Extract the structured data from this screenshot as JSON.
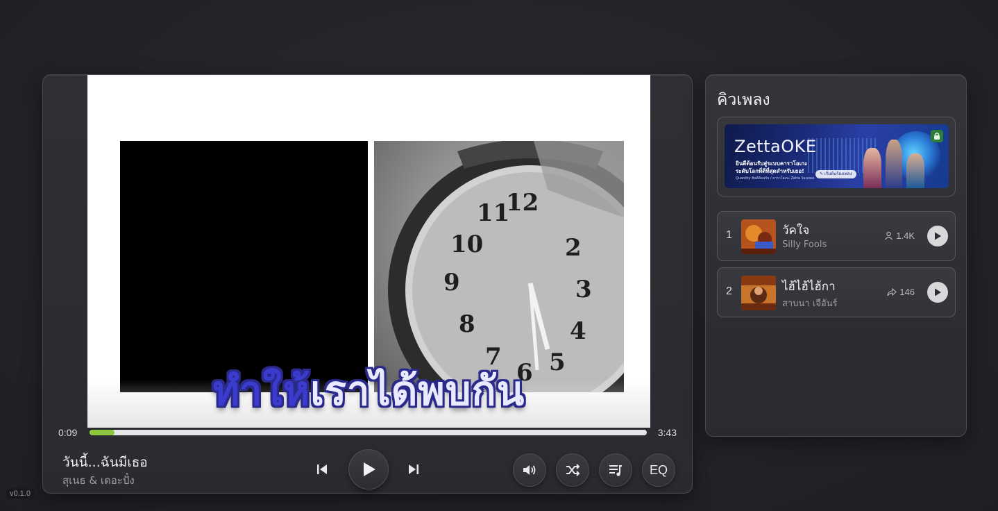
{
  "player": {
    "lyric_sung": "ทำให",
    "lyric_rest": "้เราได้พบกัน",
    "current_time": "0:09",
    "duration": "3:43",
    "progress": 0.045,
    "now_playing": {
      "title": "วันนี้...ฉันมีเธอ",
      "artist": "สุเนธ & เดอะปั๋ง"
    },
    "controls": {
      "prev_icon": "skip-previous-icon",
      "play_icon": "play-icon",
      "next_icon": "skip-next-icon",
      "volume_icon": "volume-icon",
      "shuffle_icon": "shuffle-icon",
      "queue_icon": "queue-music-icon",
      "eq_label": "EQ"
    },
    "colors": {
      "progress_fill": "#8dc63f",
      "lyric_highlight": "#3b3bd0"
    }
  },
  "queue": {
    "title": "คิวเพลง",
    "banner": {
      "brand": "ZettaOKE",
      "line1": "ยินดีต้อนรับสู่ระบบคาราโอเกะ",
      "line2": "ระดับโลกที่ดีที่สุดสำหรับเธอ!",
      "line3": "Quantity ยินดีต้อนรับ / คาราโอเกะ Zetta ร้องเพลง",
      "cta": "✎ เริ่มต้นร้องเพลง"
    },
    "items": [
      {
        "num": "1",
        "title": "วัคใจ",
        "artist": "Silly Fools",
        "stat": "1.4K",
        "stat_icon": "user-icon"
      },
      {
        "num": "2",
        "title": "ไฮ้ไฮ้ไฮ้กา",
        "artist": "สาบนา เจือันร์",
        "stat": "146",
        "stat_icon": "share-icon"
      }
    ]
  },
  "app": {
    "version": "v0.1.0"
  }
}
